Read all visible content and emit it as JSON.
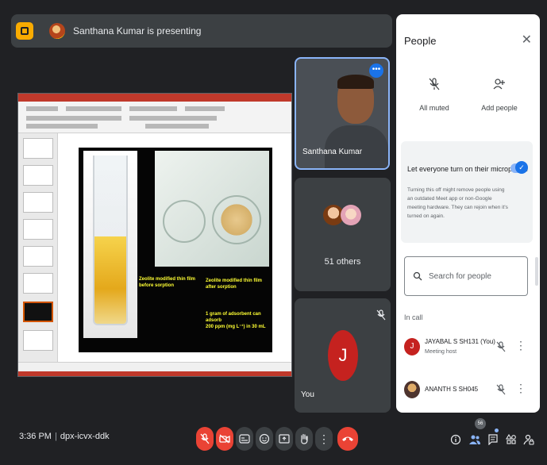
{
  "banner": {
    "presenting_text": "Santhana Kumar is presenting"
  },
  "slide": {
    "caption_before": "Zeolite modified thin film\nbefore sorption",
    "caption_after": "Zeolite modified thin film\nafter sorption",
    "caption_note": "1 gram of adsorbent can adsorb\n200 ppm (mg L⁻¹) in 30 mL"
  },
  "tiles": {
    "santhana_label": "Santhana Kumar",
    "others_label": "51 others",
    "you_initial": "J",
    "you_label": "You"
  },
  "people_panel": {
    "title": "People",
    "all_muted_label": "All muted",
    "add_people_label": "Add people",
    "mic_setting_title": "Let everyone turn on their microphone",
    "mic_setting_desc": "Turning this off might remove people using an outdated Meet app or non-Google meeting hardware. They can rejoin when it's turned on again.",
    "search_placeholder": "Search for people",
    "in_call_label": "In call",
    "participants": [
      {
        "name": "JAYABAL S SH131 (You)",
        "role": "Meeting host",
        "initial": "J"
      },
      {
        "name": "ANANTH S SH045",
        "role": ""
      }
    ]
  },
  "bottom_bar": {
    "time": "3:36 PM",
    "separator": "|",
    "meeting_code": "dpx-icvx-ddk",
    "participant_count": "56"
  },
  "colors": {
    "accent_blue": "#1a73e8",
    "end_call_red": "#ea4335",
    "avatar_red": "#c5221f",
    "meet_yellow": "#f9ab00"
  }
}
